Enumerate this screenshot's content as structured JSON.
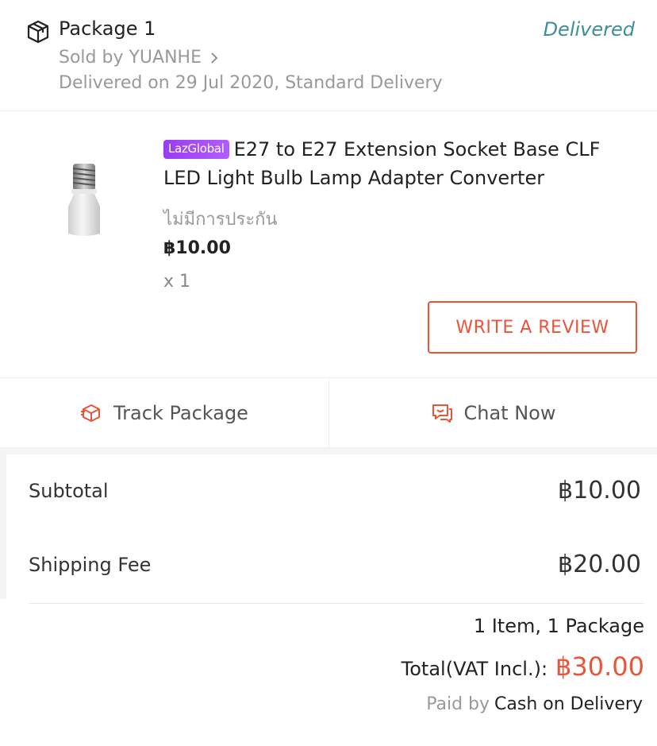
{
  "package": {
    "title": "Package 1",
    "status": "Delivered",
    "seller": "Sold by YUANHE",
    "delivery_info": "Delivered on 29 Jul 2020, Standard Delivery"
  },
  "product": {
    "badge": "LazGlobal",
    "title": "E27 to E27 Extension Socket Base CLF LED Light Bulb Lamp Adapter Converter",
    "warranty": "ไม่มีการประกัน",
    "price": "฿10.00",
    "quantity": "x 1",
    "review_button": "WRITE A REVIEW"
  },
  "actions": {
    "track_label": "Track Package",
    "chat_label": "Chat Now"
  },
  "summary": {
    "subtotal_label": "Subtotal",
    "subtotal_value": "฿10.00",
    "shipping_label": "Shipping Fee",
    "shipping_value": "฿20.00",
    "items_count": "1 Item, 1 Package",
    "total_label": "Total(VAT Incl.):",
    "total_value": "฿30.00",
    "paid_by_label": "Paid by",
    "payment_method": "Cash on Delivery"
  },
  "icons": {
    "package": "package-box-icon",
    "seller_chevron": "chevron-right-icon",
    "track": "track-package-icon",
    "chat": "chat-icon"
  },
  "colors": {
    "delivered": "#3c8e98",
    "accent": "#e8563a",
    "badge": "#a94cf5"
  }
}
